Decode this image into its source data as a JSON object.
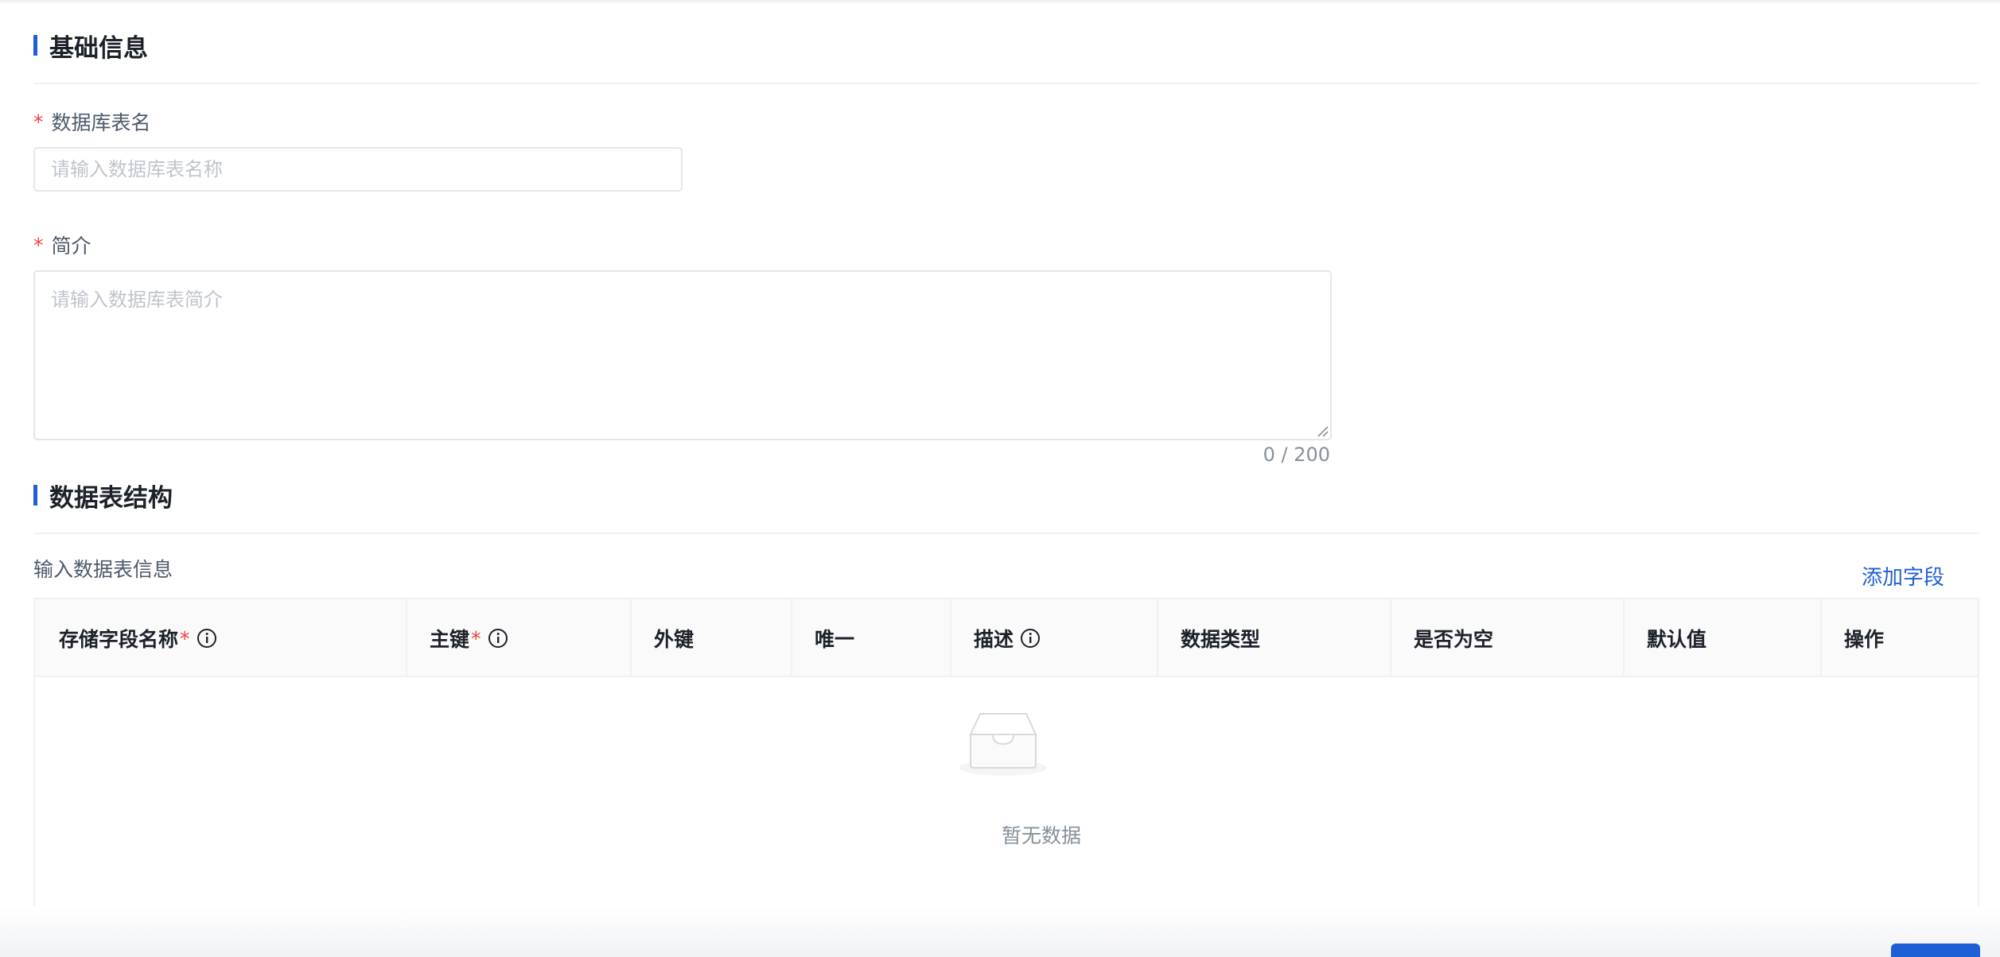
{
  "sections": {
    "basic_info": "基础信息",
    "table_structure": "数据表结构"
  },
  "form": {
    "table_name": {
      "label": "数据库表名",
      "required_mark": "*",
      "value": "",
      "placeholder": "请输入数据库表名称"
    },
    "description": {
      "label": "简介",
      "required_mark": "*",
      "value": "",
      "placeholder": "请输入数据库表简介",
      "char_count": "0 / 200"
    }
  },
  "table": {
    "hint": "输入数据表信息",
    "add_field_label": "添加字段",
    "columns": [
      {
        "label": "存储字段名称",
        "required": "*",
        "info_icon": "info-icon"
      },
      {
        "label": "主键",
        "required": "*",
        "info_icon": "info-icon"
      },
      {
        "label": "外键"
      },
      {
        "label": "唯一"
      },
      {
        "label": "描述",
        "info_icon": "info-icon"
      },
      {
        "label": "数据类型"
      },
      {
        "label": "是否为空"
      },
      {
        "label": "默认值"
      },
      {
        "label": "操作"
      }
    ],
    "empty_text": "暂无数据",
    "empty_icon": "inbox-icon"
  },
  "colors": {
    "accent": "#1f5fd6",
    "required": "#f53f3f",
    "border": "#e5e6eb",
    "header_bg": "#fafafa"
  }
}
